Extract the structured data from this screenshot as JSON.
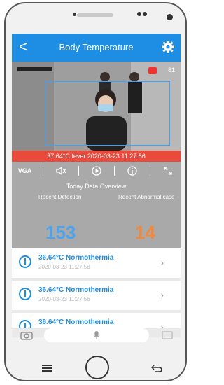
{
  "app_bar": {
    "back": "<",
    "title": "Body Temperature"
  },
  "video": {
    "counter": "81"
  },
  "fever_banner": "37.64°C fever 2020-03-23 11:27:56",
  "toolbar": {
    "vga": "VGA"
  },
  "overview": {
    "title": "Today Data Overview",
    "recent_detection_label": "Recent Detection",
    "recent_abnormal_label": "Recent Abnormal case",
    "detection_count": "153",
    "abnormal_count": "14"
  },
  "records": [
    {
      "temp": "36.64°C Normothermia",
      "time": "2020-03-23 11:27:58"
    },
    {
      "temp": "36.64°C Normothermia",
      "time": "2020-03-23 11:27:56"
    },
    {
      "temp": "36.64°C Normothermia",
      "time": ""
    }
  ],
  "colors": {
    "accent": "#1e8de4",
    "fever": "#e84a3b",
    "detection": "#4aa3ef",
    "abnormal": "#f2883a"
  }
}
